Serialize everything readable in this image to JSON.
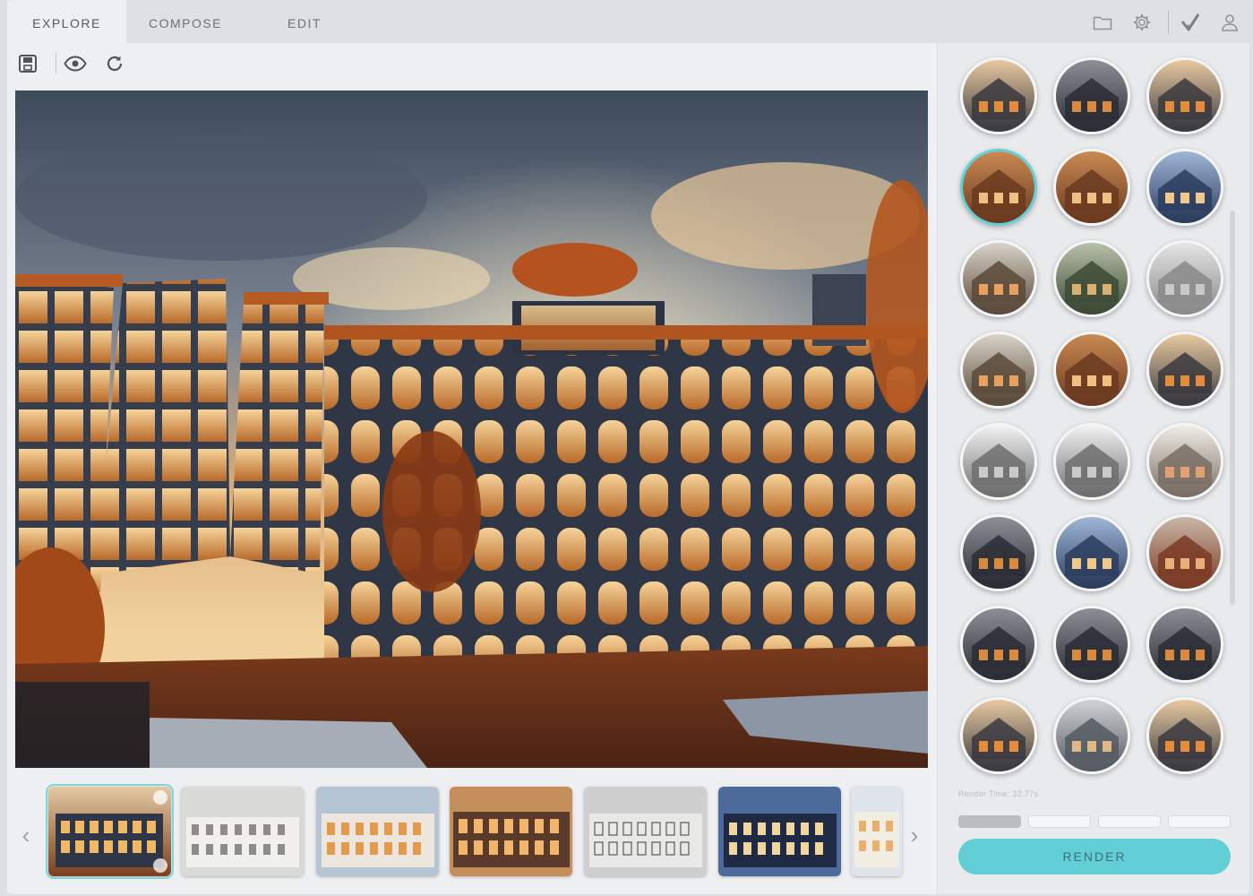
{
  "tabs": [
    {
      "label": "EXPLORE",
      "active": true
    },
    {
      "label": "COMPOSE",
      "active": false
    },
    {
      "label": "EDIT",
      "active": false
    }
  ],
  "top_icons": [
    "folder-icon",
    "gear-icon",
    "check-icon",
    "user-icon"
  ],
  "toolbar_icons": [
    "save-icon",
    "eye-icon",
    "refresh-icon"
  ],
  "main_image": {
    "subject": "render",
    "selected_index": 0
  },
  "filmstrip": {
    "left_arrow": "‹",
    "right_arrow": "›",
    "thumbnails": [
      {
        "tone": "warm-dusk",
        "selected": true
      },
      {
        "tone": "monochrome-light",
        "selected": false
      },
      {
        "tone": "warm-day",
        "selected": false
      },
      {
        "tone": "warm-evening",
        "selected": false
      },
      {
        "tone": "monochrome-sketch",
        "selected": false
      },
      {
        "tone": "blue-evening",
        "selected": false
      },
      {
        "tone": "pastel",
        "selected": false
      }
    ]
  },
  "gallery": [
    {
      "tone": "warm",
      "selected": false
    },
    {
      "tone": "dark",
      "selected": false
    },
    {
      "tone": "warm",
      "selected": false
    },
    {
      "tone": "copper",
      "selected": true
    },
    {
      "tone": "copper",
      "selected": false
    },
    {
      "tone": "blue",
      "selected": false
    },
    {
      "tone": "interior",
      "selected": false
    },
    {
      "tone": "interior-green",
      "selected": false
    },
    {
      "tone": "interior-grey",
      "selected": false
    },
    {
      "tone": "interior",
      "selected": false
    },
    {
      "tone": "copper",
      "selected": false
    },
    {
      "tone": "warm",
      "selected": false
    },
    {
      "tone": "sketch",
      "selected": false
    },
    {
      "tone": "sketch",
      "selected": false
    },
    {
      "tone": "sketch-warm",
      "selected": false
    },
    {
      "tone": "dark",
      "selected": false
    },
    {
      "tone": "blue",
      "selected": false
    },
    {
      "tone": "brick",
      "selected": false
    },
    {
      "tone": "dark",
      "selected": false
    },
    {
      "tone": "dark",
      "selected": false
    },
    {
      "tone": "dark",
      "selected": false
    },
    {
      "tone": "warm",
      "selected": false
    },
    {
      "tone": "grey",
      "selected": false
    },
    {
      "tone": "warm",
      "selected": false
    }
  ],
  "render_panel": {
    "render_time": "Render Time: 32.77s",
    "progress_segments_filled": 1,
    "progress_segments_total": 4,
    "render_label": "RENDER"
  },
  "colors": {
    "accent": "#62cfd6",
    "selected_border": "#5fd0d6",
    "panel_bg": "#e9eaec"
  }
}
